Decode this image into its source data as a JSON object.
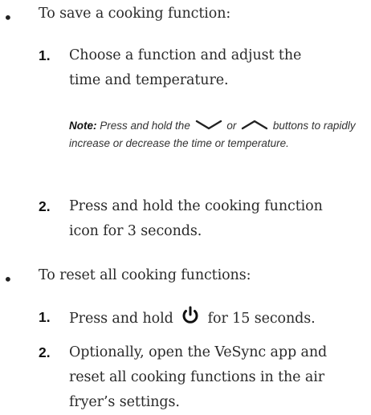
{
  "section1": {
    "bullet": "•",
    "heading": "To save a cooking function:",
    "step1": {
      "number": "1.",
      "line1": "Choose a function and adjust the",
      "line2": "time and temperature."
    },
    "note": {
      "label": "Note:",
      "part1": " Press and hold the ",
      "part2": " or ",
      "part3": " buttons to rapidly increase or decrease the time or temperature."
    },
    "step2": {
      "number": "2.",
      "line1": "Press and hold the cooking function",
      "line2": "icon for 3 seconds."
    }
  },
  "section2": {
    "bullet": "•",
    "heading": "To reset all cooking functions:",
    "step1": {
      "number": "1.",
      "before": "Press and hold ",
      "after": " for 15 seconds."
    },
    "step2": {
      "number": "2.",
      "line1": "Optionally, open the VeSync app and",
      "line2": "reset all cooking functions in the air",
      "line3": "fryer’s settings."
    }
  },
  "icons": {
    "down": "chevron-down-icon",
    "up": "chevron-up-icon",
    "power": "power-icon"
  }
}
